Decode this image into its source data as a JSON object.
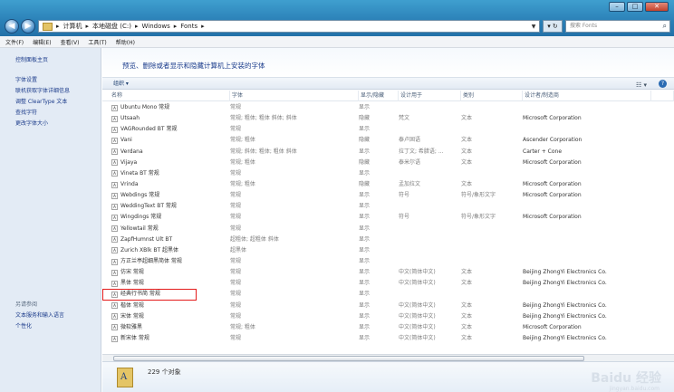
{
  "address": {
    "crumbs": [
      "计算机",
      "本地磁盘 (C:)",
      "Windows",
      "Fonts"
    ],
    "search_placeholder": "搜索 Fonts"
  },
  "menu": [
    "文件(F)",
    "编辑(E)",
    "查看(V)",
    "工具(T)",
    "帮助(H)"
  ],
  "sidebar": {
    "home": "控制面板主页",
    "links": [
      "字体设置",
      "联机获取字体详细信息",
      "调整 ClearType 文本",
      "查找字符",
      "更改字体大小"
    ],
    "see_also": "另请参阅",
    "bottom_links": [
      "文本服务和输入语言",
      "个性化"
    ]
  },
  "header": {
    "title": "预览、删除或者显示和隐藏计算机上安装的字体",
    "organize": "组织 ▾"
  },
  "columns": [
    "名称",
    "字体",
    "显示/隐藏",
    "设计用于",
    "类别",
    "设计者/制造商"
  ],
  "rows": [
    {
      "name": "Ubuntu Mono 常规",
      "style": "常规",
      "show": "显示",
      "for": "",
      "cat": "",
      "maker": ""
    },
    {
      "name": "Utsaah",
      "style": "常规; 粗体; 粗体 斜体; 斜体",
      "show": "隐藏",
      "for": "梵文",
      "cat": "文本",
      "maker": "Microsoft Corporation"
    },
    {
      "name": "VAGRounded BT 常规",
      "style": "常规",
      "show": "显示",
      "for": "",
      "cat": "",
      "maker": ""
    },
    {
      "name": "Vani",
      "style": "常规; 粗体",
      "show": "隐藏",
      "for": "泰卢固语",
      "cat": "文本",
      "maker": "Ascender Corporation"
    },
    {
      "name": "Verdana",
      "style": "常规; 斜体; 粗体; 粗体 斜体",
      "show": "显示",
      "for": "拉丁文; 希腊语; ...",
      "cat": "文本",
      "maker": "Carter + Cone"
    },
    {
      "name": "Vijaya",
      "style": "常规; 粗体",
      "show": "隐藏",
      "for": "泰米尔语",
      "cat": "文本",
      "maker": "Microsoft Corporation"
    },
    {
      "name": "Vineta BT 常规",
      "style": "常规",
      "show": "显示",
      "for": "",
      "cat": "",
      "maker": ""
    },
    {
      "name": "Vrinda",
      "style": "常规; 粗体",
      "show": "隐藏",
      "for": "孟加拉文",
      "cat": "文本",
      "maker": "Microsoft Corporation"
    },
    {
      "name": "Webdings 常规",
      "style": "常规",
      "show": "显示",
      "for": "符号",
      "cat": "符号/象形文字",
      "maker": "Microsoft Corporation"
    },
    {
      "name": "WeddingText BT 常规",
      "style": "常规",
      "show": "显示",
      "for": "",
      "cat": "",
      "maker": ""
    },
    {
      "name": "Wingdings 常规",
      "style": "常规",
      "show": "显示",
      "for": "符号",
      "cat": "符号/象形文字",
      "maker": "Microsoft Corporation"
    },
    {
      "name": "Yellowtail 常规",
      "style": "常规",
      "show": "显示",
      "for": "",
      "cat": "",
      "maker": ""
    },
    {
      "name": "ZapfHumnst Ult BT",
      "style": "超粗体; 超粗体 斜体",
      "show": "显示",
      "for": "",
      "cat": "",
      "maker": ""
    },
    {
      "name": "Zurich XBlk BT 超黑体",
      "style": "超黑体",
      "show": "显示",
      "for": "",
      "cat": "",
      "maker": ""
    },
    {
      "name": "方正兰亭超细黑简体 常规",
      "style": "常规",
      "show": "显示",
      "for": "",
      "cat": "",
      "maker": ""
    },
    {
      "name": "仿宋 常规",
      "style": "常规",
      "show": "显示",
      "for": "中文(简体中文)",
      "cat": "文本",
      "maker": "Beijing ZhongYi Electronics Co."
    },
    {
      "name": "黑体 常规",
      "style": "常规",
      "show": "显示",
      "for": "中文(简体中文)",
      "cat": "文本",
      "maker": "Beijing ZhongYi Electronics Co."
    },
    {
      "name": "经典行书简 常规",
      "style": "常规",
      "show": "显示",
      "for": "",
      "cat": "",
      "maker": ""
    },
    {
      "name": "楷体 常规",
      "style": "常规",
      "show": "显示",
      "for": "中文(简体中文)",
      "cat": "文本",
      "maker": "Beijing ZhongYi Electronics Co."
    },
    {
      "name": "宋体 常规",
      "style": "常规",
      "show": "显示",
      "for": "中文(简体中文)",
      "cat": "文本",
      "maker": "Beijing ZhongYi Electronics Co."
    },
    {
      "name": "微软雅黑",
      "style": "常规; 粗体",
      "show": "显示",
      "for": "中文(简体中文)",
      "cat": "文本",
      "maker": "Microsoft Corporation"
    },
    {
      "name": "新宋体 常规",
      "style": "常规",
      "show": "显示",
      "for": "中文(简体中文)",
      "cat": "文本",
      "maker": "Beijing ZhongYi Electronics Co."
    }
  ],
  "selected_row": 17,
  "details": {
    "count": "229 个对象"
  },
  "watermark": {
    "main": "Baidu 经验",
    "sub": "jingyan.baidu.com"
  }
}
